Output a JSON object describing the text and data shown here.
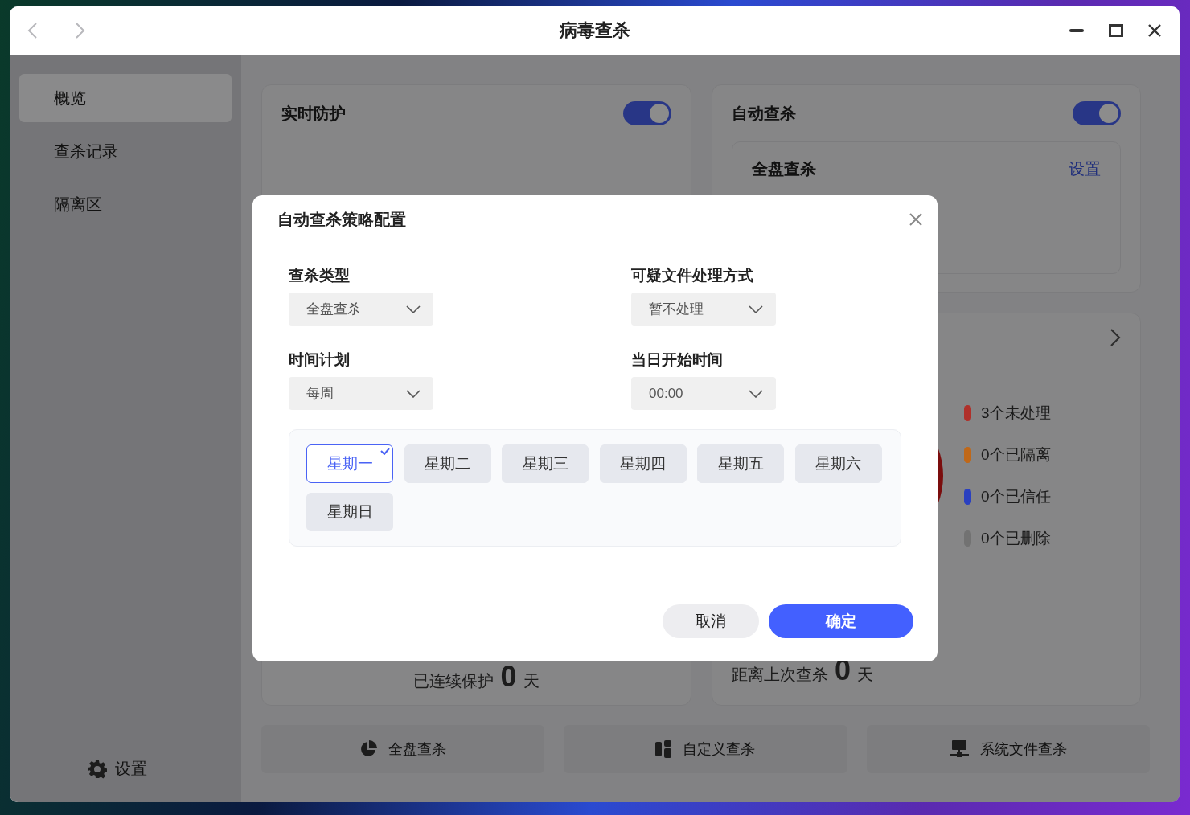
{
  "window": {
    "title": "病毒查杀"
  },
  "sidebar": {
    "items": [
      {
        "label": "概览",
        "selected": true
      },
      {
        "label": "查杀记录",
        "selected": false
      },
      {
        "label": "隔离区",
        "selected": false
      }
    ],
    "settings": "设置"
  },
  "realtime_card": {
    "title": "实时防护",
    "on": true,
    "protection": {
      "prefix": "已连续保护",
      "value": "0",
      "unit": "天"
    }
  },
  "auto_scan_card": {
    "title": "自动查杀",
    "on": true,
    "plan": {
      "title": "全盘查杀",
      "action": "设置"
    }
  },
  "results_card": {
    "legend": [
      {
        "label": "3个未处理",
        "color": "#b0302a"
      },
      {
        "label": "0个已隔离",
        "color": "#c06818"
      },
      {
        "label": "0个已信任",
        "color": "#2a40c0"
      },
      {
        "label": "0个已删除",
        "color": "#727272"
      }
    ],
    "last_scan": {
      "prefix": "距离上次查杀",
      "value": "0",
      "unit": "天"
    }
  },
  "actions": [
    {
      "label": "全盘查杀",
      "kind": "pie"
    },
    {
      "label": "自定义查杀",
      "kind": "blocks"
    },
    {
      "label": "系统文件查杀",
      "kind": "monitor"
    }
  ],
  "dialog": {
    "title": "自动查杀策略配置",
    "fields": [
      {
        "label": "查杀类型",
        "value": "全盘查杀"
      },
      {
        "label": "可疑文件处理方式",
        "value": "暂不处理"
      },
      {
        "label": "时间计划",
        "value": "每周"
      },
      {
        "label": "当日开始时间",
        "value": "00:00"
      }
    ],
    "days": [
      {
        "label": "星期一",
        "selected": true
      },
      {
        "label": "星期二",
        "selected": false
      },
      {
        "label": "星期三",
        "selected": false
      },
      {
        "label": "星期四",
        "selected": false
      },
      {
        "label": "星期五",
        "selected": false
      },
      {
        "label": "星期六",
        "selected": false
      },
      {
        "label": "星期日",
        "selected": false
      }
    ],
    "buttons": [
      {
        "label": "取消",
        "kind": "secondary"
      },
      {
        "label": "确定",
        "kind": "primary"
      }
    ]
  }
}
